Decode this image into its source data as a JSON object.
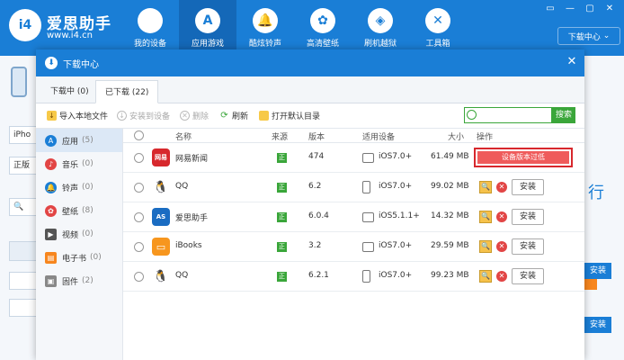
{
  "header": {
    "logo_text": "i4",
    "app_name": "爱思助手",
    "url": "www.i4.cn",
    "nav": [
      {
        "label": "我的设备",
        "icon": "apple-icon",
        "glyph": ""
      },
      {
        "label": "应用游戏",
        "icon": "app-store-icon",
        "glyph": "A"
      },
      {
        "label": "酷炫铃声",
        "icon": "bell-icon",
        "glyph": "🔔"
      },
      {
        "label": "高清壁纸",
        "icon": "flower-icon",
        "glyph": "✿"
      },
      {
        "label": "刷机越狱",
        "icon": "box-icon",
        "glyph": "◈"
      },
      {
        "label": "工具箱",
        "icon": "tools-icon",
        "glyph": "✕"
      }
    ],
    "download_center_label": "下载中心",
    "window_controls": [
      "▭",
      "—",
      "▢",
      "✕"
    ]
  },
  "background": {
    "left_boxes": [
      "iPho",
      "正版",
      "🔍"
    ],
    "right_text": "行",
    "right_buttons": [
      "安装",
      "安装"
    ]
  },
  "dialog": {
    "title": "下载中心",
    "title_icon_glyph": "⬇",
    "close_glyph": "✕",
    "tabs": [
      {
        "label": "下载中 (0)"
      },
      {
        "label": "已下载 (22)"
      }
    ],
    "toolbar": {
      "import_label": "导入本地文件",
      "install_label": "安装到设备",
      "delete_label": "删除",
      "refresh_label": "刷新",
      "open_dir_label": "打开默认目录",
      "search_placeholder": "",
      "search_button": "搜索"
    },
    "categories": [
      {
        "label": "应用",
        "count": "(5)",
        "color": "#1a7ed6",
        "glyph": "A"
      },
      {
        "label": "音乐",
        "count": "(0)",
        "color": "#e24545",
        "glyph": "♪"
      },
      {
        "label": "铃声",
        "count": "(0)",
        "color": "#1a7ed6",
        "glyph": "🔔"
      },
      {
        "label": "壁纸",
        "count": "(8)",
        "color": "#e24545",
        "glyph": "✿"
      },
      {
        "label": "视频",
        "count": "(0)",
        "color": "#555555",
        "glyph": "▶"
      },
      {
        "label": "电子书",
        "count": "(0)",
        "color": "#f7861e",
        "glyph": "▤"
      },
      {
        "label": "固件",
        "count": "(2)",
        "color": "#888888",
        "glyph": "▣"
      }
    ],
    "columns": {
      "name": "名称",
      "source": "来源",
      "version": "版本",
      "device": "适用设备",
      "size": "大小",
      "action": "操作"
    },
    "rows": [
      {
        "name": "网易新闻",
        "icon_text": "网易",
        "icon_color": "#d7282d",
        "source": "正",
        "version": "474",
        "device": "iOS7.0+",
        "size": "61.49 MB",
        "warning": "设备版本过低"
      },
      {
        "name": "QQ",
        "icon_text": "🐧",
        "icon_color": "#ffffff",
        "source": "正",
        "version": "6.2",
        "device": "iOS7.0+",
        "size": "99.02 MB",
        "install": "安装"
      },
      {
        "name": "爱思助手",
        "icon_text": "AS",
        "icon_color": "#1a6cc2",
        "source": "正",
        "version": "6.0.4",
        "device": "iOS5.1.1+",
        "size": "14.32 MB",
        "install": "安装"
      },
      {
        "name": "iBooks",
        "icon_text": "▭",
        "icon_color": "#f7961e",
        "source": "正",
        "version": "3.2",
        "device": "iOS7.0+",
        "size": "29.59 MB",
        "install": "安装"
      },
      {
        "name": "QQ",
        "icon_text": "🐧",
        "icon_color": "#ffffff",
        "source": "正",
        "version": "6.2.1",
        "device": "iOS7.0+",
        "size": "99.23 MB",
        "install": "安装"
      }
    ],
    "action_icons": {
      "find": "🔍",
      "delete": "✕"
    }
  }
}
